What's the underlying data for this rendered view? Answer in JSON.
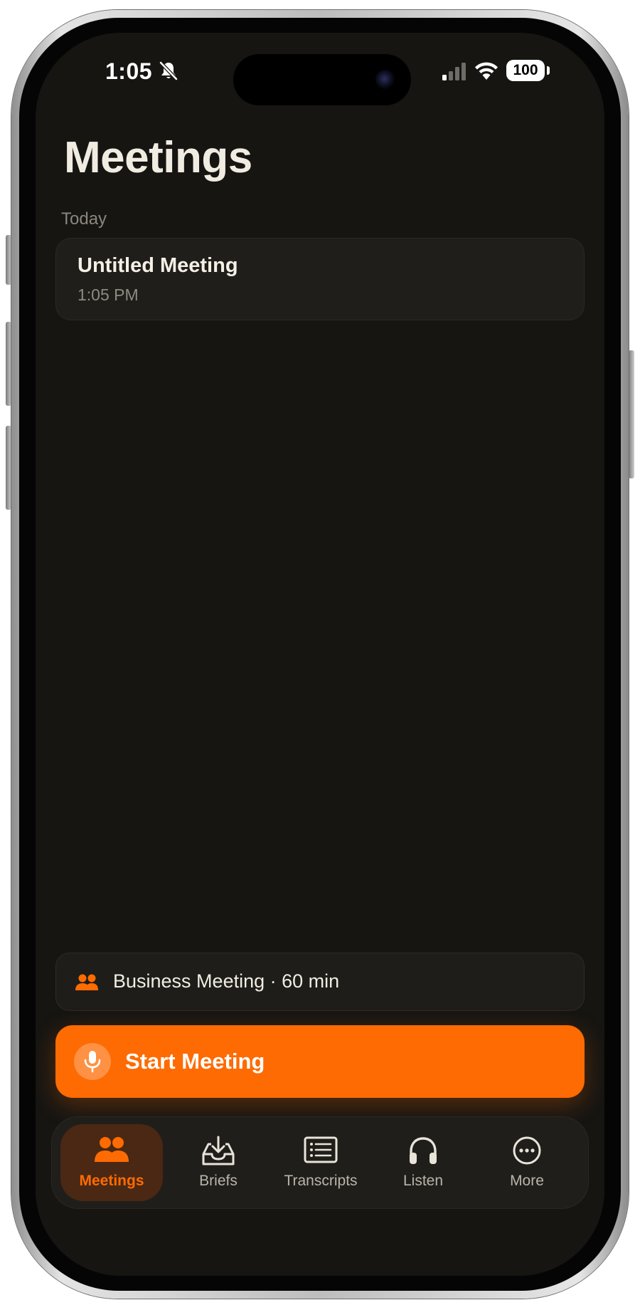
{
  "status_bar": {
    "time": "1:05",
    "battery": "100",
    "icons": [
      "bell-slash-icon",
      "cellular-signal-icon",
      "wifi-icon",
      "battery-icon"
    ]
  },
  "header": {
    "title": "Meetings"
  },
  "sections": [
    {
      "label": "Today",
      "items": [
        {
          "title": "Untitled Meeting",
          "time": "1:05 PM"
        }
      ]
    }
  ],
  "template_selector": {
    "icon": "people-icon",
    "label": "Business Meeting · 60 min"
  },
  "start_button": {
    "icon": "microphone-icon",
    "label": "Start Meeting"
  },
  "tabbar": {
    "tabs": [
      {
        "label": "Meetings",
        "icon": "people-icon",
        "active": true
      },
      {
        "label": "Briefs",
        "icon": "tray-download-icon",
        "active": false
      },
      {
        "label": "Transcripts",
        "icon": "list-document-icon",
        "active": false
      },
      {
        "label": "Listen",
        "icon": "headphones-icon",
        "active": false
      },
      {
        "label": "More",
        "icon": "ellipsis-circle-icon",
        "active": false
      }
    ]
  },
  "colors": {
    "accent": "#fe6b02",
    "background": "#161512",
    "card": "#201e1a",
    "active_tab_bg": "#4a2814",
    "title_text": "#f1ece1"
  }
}
